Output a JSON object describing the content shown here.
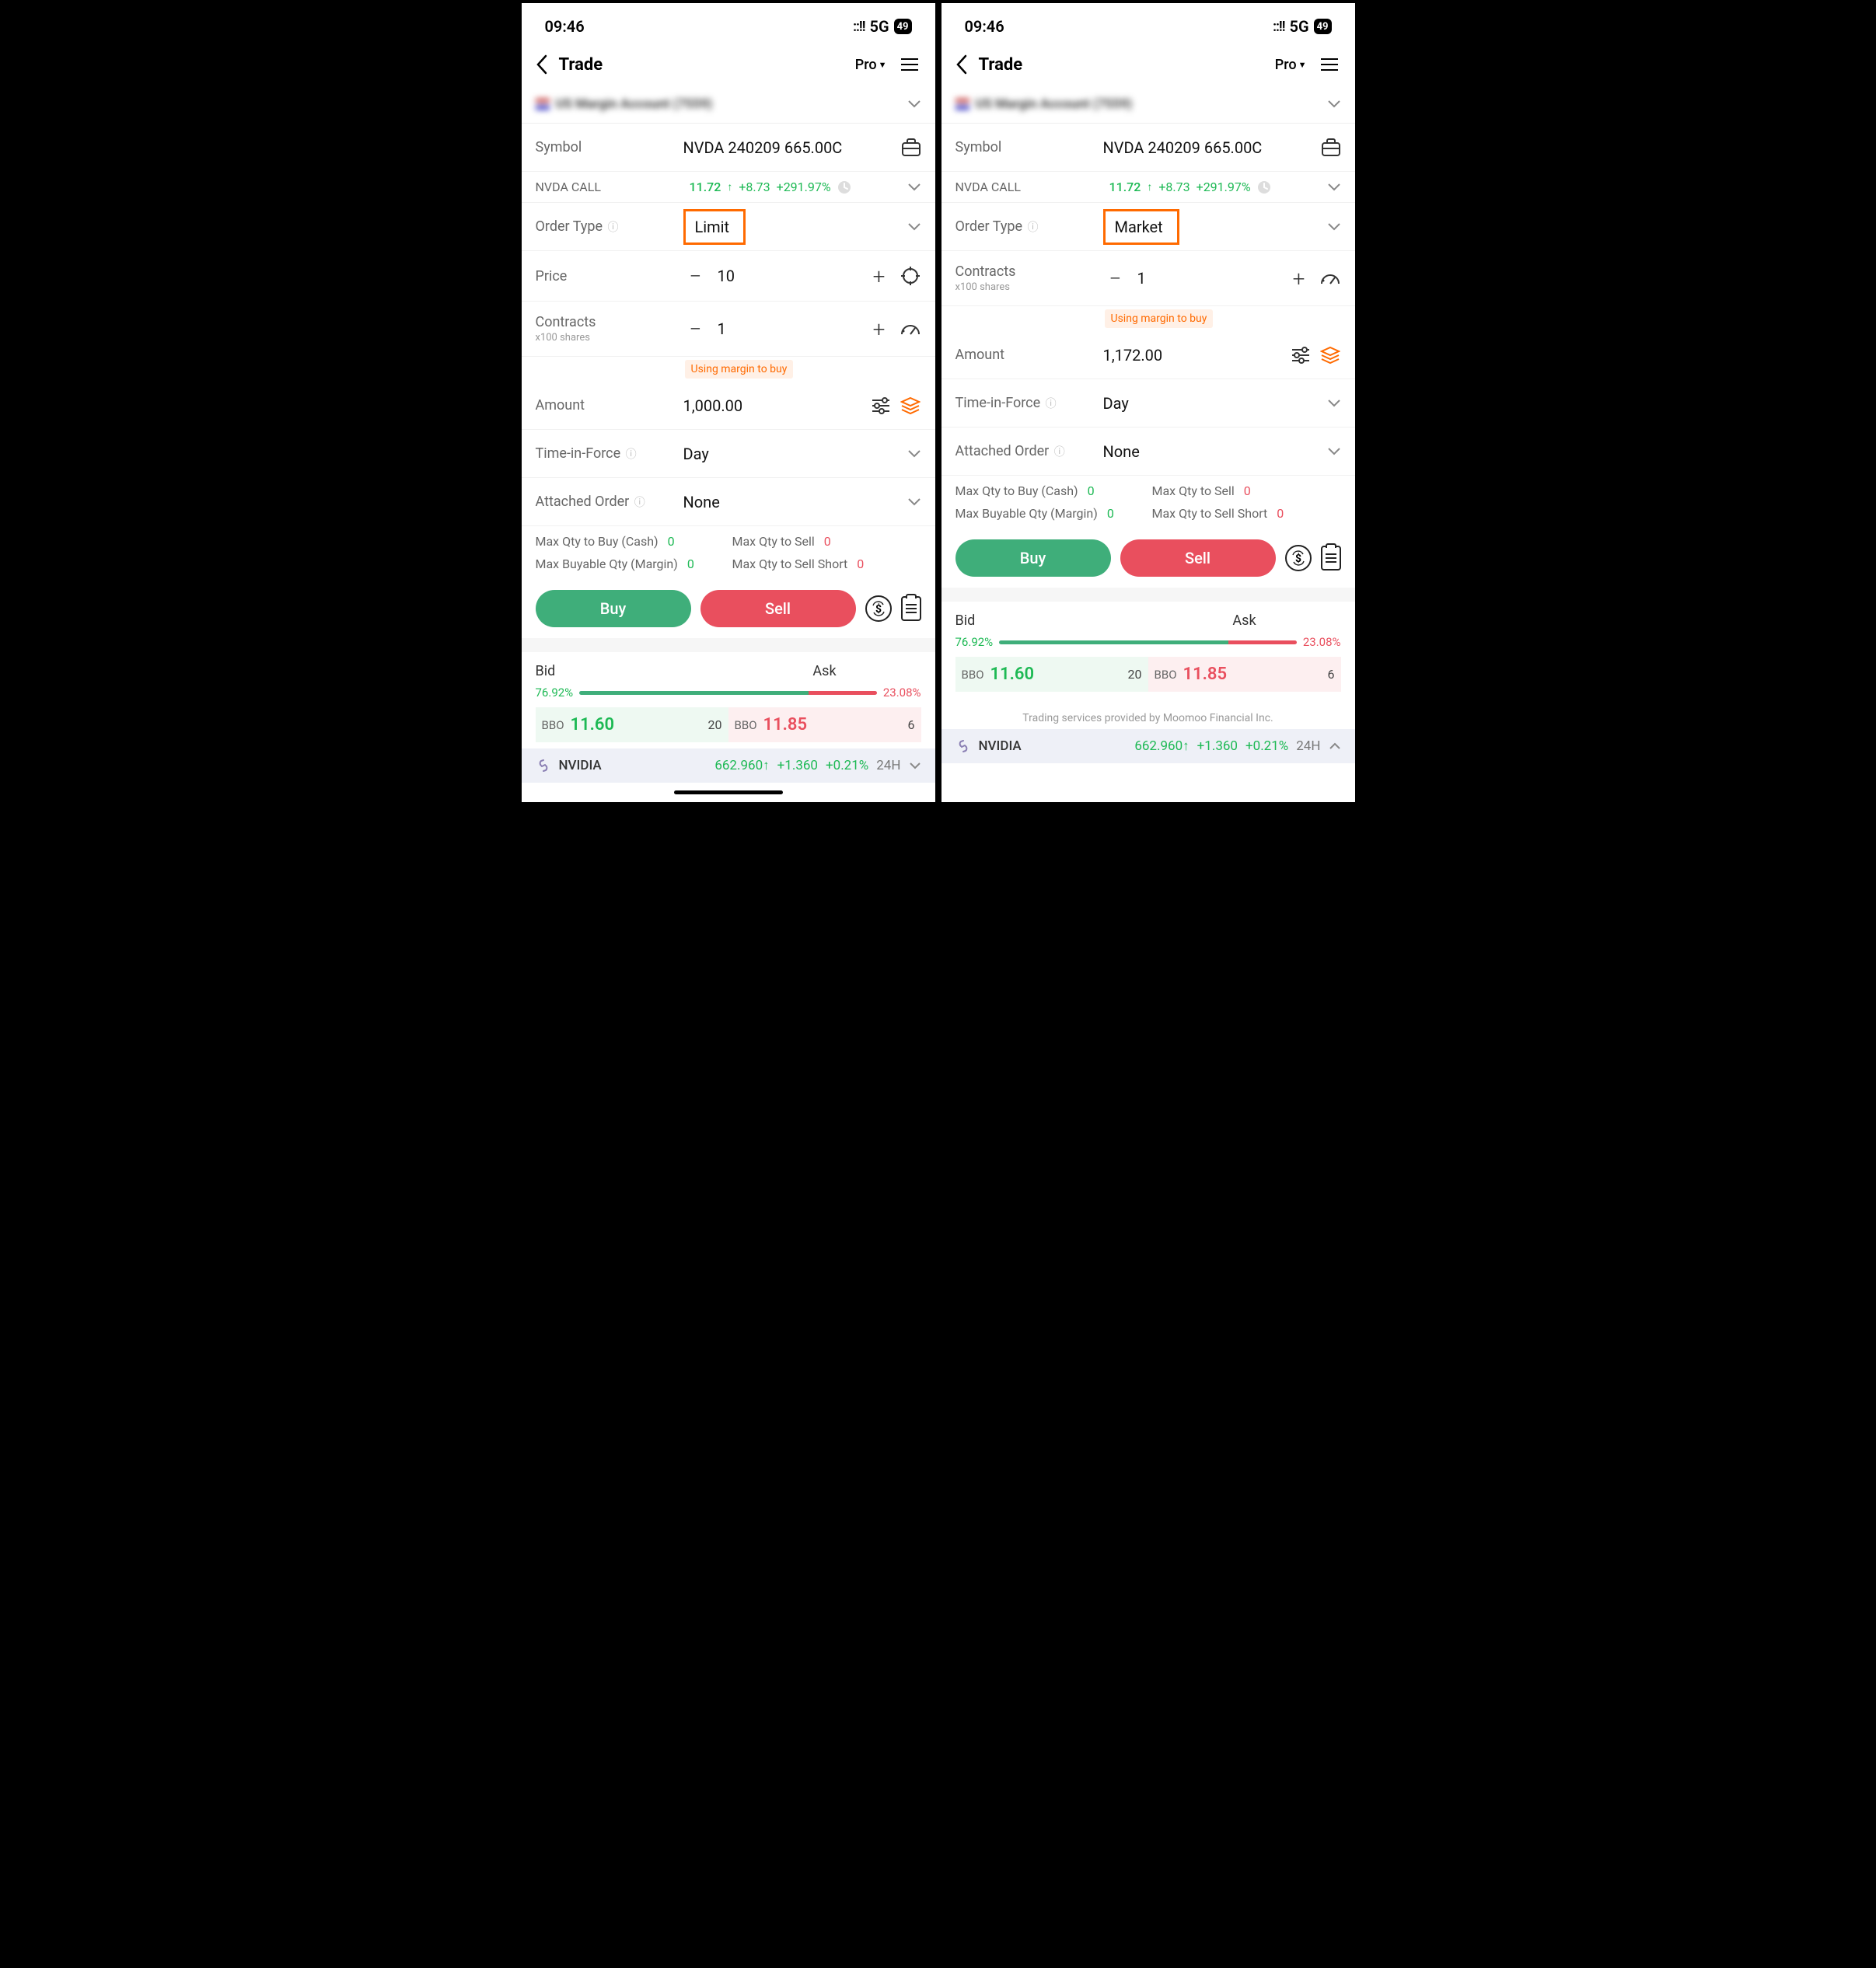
{
  "status": {
    "time": "09:46",
    "net": "5G",
    "battery": "49"
  },
  "header": {
    "title": "Trade",
    "pro": "Pro"
  },
  "account": {
    "name": "US Margin Account (7559)",
    "link": ""
  },
  "symbol": {
    "label": "Symbol",
    "value": "NVDA 240209 665.00C"
  },
  "quote": {
    "name": "NVDA CALL",
    "price": "11.72",
    "chg": "+8.73",
    "pct": "+291.97%"
  },
  "left": {
    "orderType": {
      "label": "Order Type",
      "value": "Limit"
    },
    "price": {
      "label": "Price",
      "value": "10"
    },
    "contracts": {
      "label": "Contracts",
      "sub": "x100 shares",
      "value": "1"
    },
    "badge": "Using margin to buy",
    "amount": {
      "label": "Amount",
      "value": "1,000.00"
    },
    "tif": {
      "label": "Time-in-Force",
      "value": "Day"
    },
    "attached": {
      "label": "Attached Order",
      "value": "None"
    }
  },
  "right": {
    "orderType": {
      "label": "Order Type",
      "value": "Market"
    },
    "contracts": {
      "label": "Contracts",
      "sub": "x100 shares",
      "value": "1"
    },
    "badge": "Using margin to buy",
    "amount": {
      "label": "Amount",
      "value": "1,172.00"
    },
    "tif": {
      "label": "Time-in-Force",
      "value": "Day"
    },
    "attached": {
      "label": "Attached Order",
      "value": "None"
    }
  },
  "maxQty": {
    "buyCash": {
      "label": "Max Qty to Buy (Cash)",
      "value": "0"
    },
    "sell": {
      "label": "Max Qty to Sell",
      "value": "0"
    },
    "buyMargin": {
      "label": "Max Buyable Qty (Margin)",
      "value": "0"
    },
    "sellShort": {
      "label": "Max Qty to Sell Short",
      "value": "0"
    }
  },
  "buttons": {
    "buy": "Buy",
    "sell": "Sell"
  },
  "bidask": {
    "bidLabel": "Bid",
    "askLabel": "Ask",
    "bidPct": "76.92%",
    "askPct": "23.08%",
    "bbo": "BBO",
    "bidPrice": "11.60",
    "bidQty": "20",
    "askPrice": "11.85",
    "askQty": "6"
  },
  "ticker": {
    "name": "NVIDIA",
    "price": "662.960",
    "chg": "+1.360",
    "pct": "+0.21%",
    "period": "24H"
  },
  "disclaimer": "Trading services provided by Moomoo Financial Inc."
}
